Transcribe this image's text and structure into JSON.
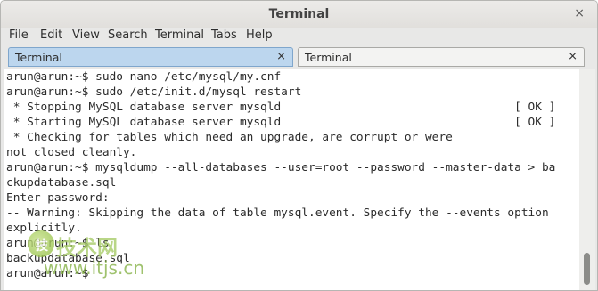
{
  "window": {
    "title": "Terminal",
    "close_glyph": "×"
  },
  "menu": {
    "items": [
      "File",
      "Edit",
      "View",
      "Search",
      "Terminal",
      "Tabs",
      "Help"
    ]
  },
  "tabs": [
    {
      "label": "Terminal",
      "active": true,
      "close_glyph": "×"
    },
    {
      "label": "Terminal",
      "active": false,
      "close_glyph": "×"
    }
  ],
  "terminal": {
    "lines": [
      "arun@arun:~$ sudo nano /etc/mysql/my.cnf",
      "arun@arun:~$ sudo /etc/init.d/mysql restart",
      " * Stopping MySQL database server mysqld                                  [ OK ]",
      " * Starting MySQL database server mysqld                                  [ OK ]",
      " * Checking for tables which need an upgrade, are corrupt or were",
      "not closed cleanly.",
      "arun@arun:~$ mysqldump --all-databases --user=root --password --master-data > ba",
      "ckupdatabase.sql",
      "Enter password:",
      "-- Warning: Skipping the data of table mysql.event. Specify the --events option",
      "explicitly.",
      "arun@arun:~$ ls",
      "backupdatabase.sql",
      "arun@arun:~$ "
    ]
  },
  "watermark": {
    "logo_text": "技",
    "brand_text": "技术网",
    "url_text": "www.itjs.cn"
  },
  "colors": {
    "active_tab": "#bcd6ee",
    "terminal_background": "#ffffff",
    "terminal_text": "#2b2b2b",
    "watermark": "#8cbb3a"
  }
}
